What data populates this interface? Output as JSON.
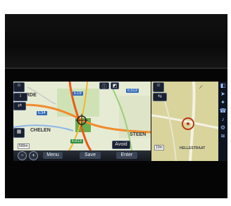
{
  "map": {
    "labels": [
      "RDE",
      "CHELEN",
      "STEEN",
      "HELLESTRAAT"
    ],
    "road_shields": [
      "E19",
      "E313",
      "E34",
      "E313"
    ],
    "scale_left": "500m",
    "scale_right": "10m"
  },
  "toolbar": {
    "menu_label": "Menu",
    "save_label": "Save",
    "enter_label": "Enter",
    "avoid_label": "Avoid"
  },
  "icons": [
    "map-icon",
    "arrow-icon",
    "compass-icon",
    "phone-icon",
    "music-icon",
    "settings-icon",
    "climate-icon"
  ]
}
